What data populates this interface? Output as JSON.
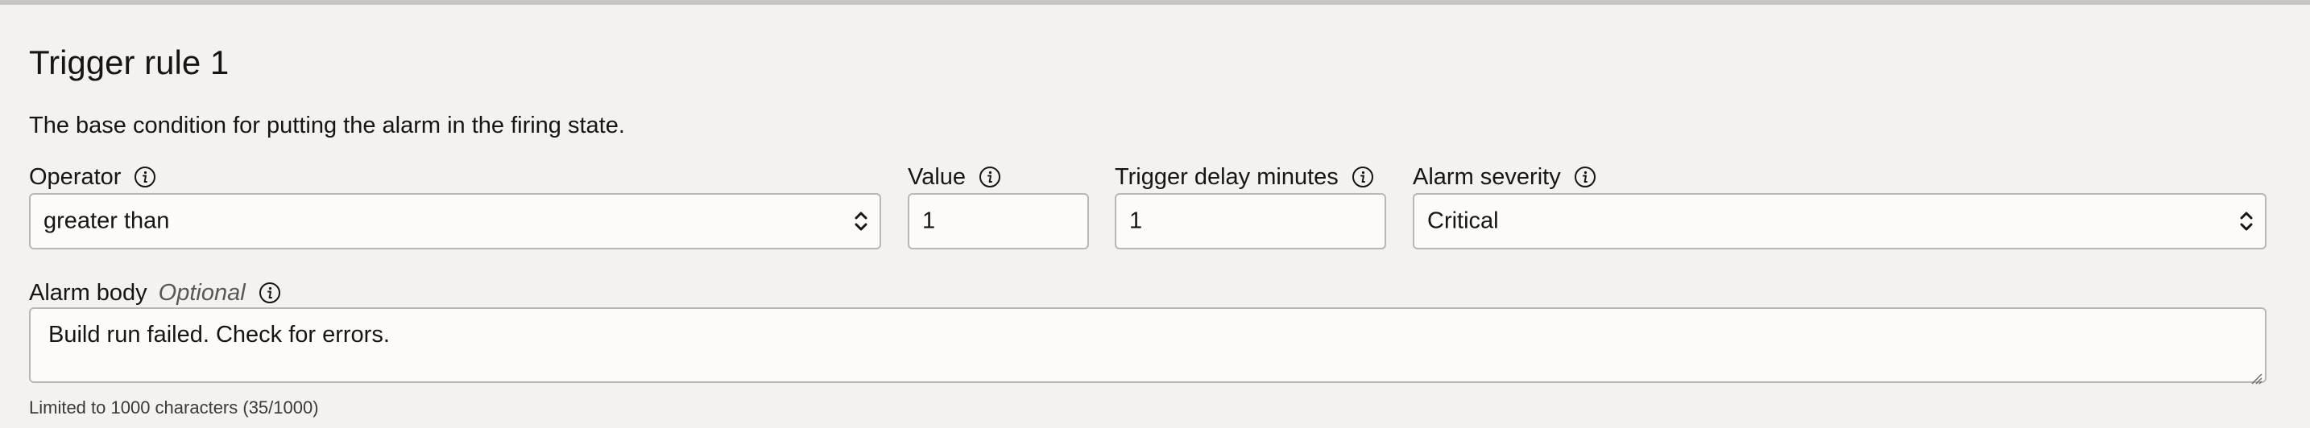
{
  "section": {
    "title": "Trigger rule 1",
    "description": "The base condition for putting the alarm in the firing state."
  },
  "fields": {
    "operator": {
      "label": "Operator",
      "value": "greater than"
    },
    "value": {
      "label": "Value",
      "value": "1"
    },
    "trigger_delay": {
      "label": "Trigger delay minutes",
      "value": "1"
    },
    "alarm_severity": {
      "label": "Alarm severity",
      "value": "Critical"
    },
    "alarm_body": {
      "label": "Alarm body",
      "optional_label": "Optional",
      "value": "Build run failed. Check for errors.",
      "hint": "Limited to 1000 characters (35/1000)"
    }
  },
  "icons": {
    "info": "info-icon",
    "select": "chevron-up-down-icon",
    "resize": "resize-grip-icon"
  },
  "colors": {
    "background": "#f3f2f1",
    "field_background": "#fcfbfa",
    "field_border": "#b9b6b3",
    "text": "#161513"
  }
}
